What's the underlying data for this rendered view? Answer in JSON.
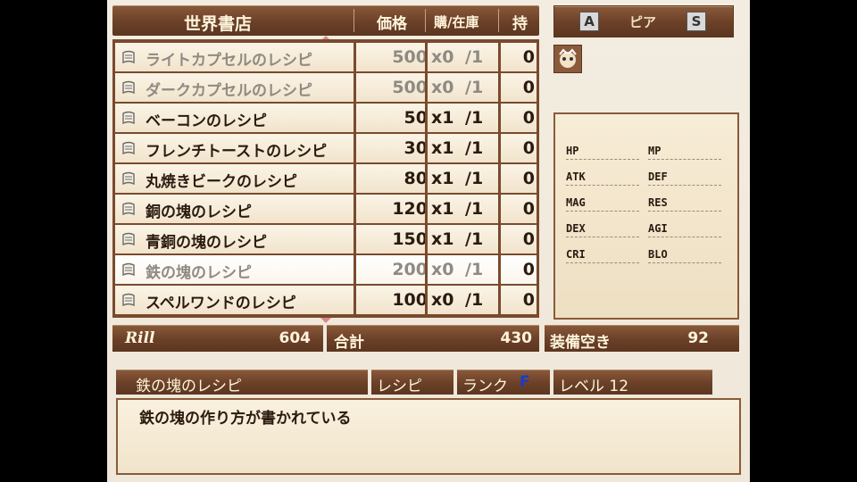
{
  "header": {
    "title": "世界書店",
    "col_price": "価格",
    "col_buy_stock": "購/在庫",
    "col_own": "持"
  },
  "items": [
    {
      "name": "ライトカプセルのレシピ",
      "price": "500",
      "buy": "x0",
      "stock": "/1",
      "own": "0",
      "greyed": true
    },
    {
      "name": "ダークカプセルのレシピ",
      "price": "500",
      "buy": "x0",
      "stock": "/1",
      "own": "0",
      "greyed": true
    },
    {
      "name": "ベーコンのレシピ",
      "price": "50",
      "buy": "x1",
      "stock": "/1",
      "own": "0",
      "greyed": false
    },
    {
      "name": "フレンチトーストのレシピ",
      "price": "30",
      "buy": "x1",
      "stock": "/1",
      "own": "0",
      "greyed": false
    },
    {
      "name": "丸焼きビークのレシピ",
      "price": "80",
      "buy": "x1",
      "stock": "/1",
      "own": "0",
      "greyed": false
    },
    {
      "name": "銅の塊のレシピ",
      "price": "120",
      "buy": "x1",
      "stock": "/1",
      "own": "0",
      "greyed": false
    },
    {
      "name": "青銅の塊のレシピ",
      "price": "150",
      "buy": "x1",
      "stock": "/1",
      "own": "0",
      "greyed": false
    },
    {
      "name": "鉄の塊のレシピ",
      "price": "200",
      "buy": "x0",
      "stock": "/1",
      "own": "0",
      "greyed": true,
      "selected": true
    },
    {
      "name": "スペルワンドのレシピ",
      "price": "100",
      "buy": "x0",
      "stock": "/1",
      "own": "0",
      "greyed": false
    }
  ],
  "totals": {
    "rill_label": "Rill",
    "rill_value": "604",
    "sum_label": "合計",
    "sum_value": "430",
    "slot_label": "装備空き",
    "slot_value": "92"
  },
  "character": {
    "key_left": "A",
    "name": "ピア",
    "key_right": "S"
  },
  "stats": [
    "HP",
    "MP",
    "ATK",
    "DEF",
    "MAG",
    "RES",
    "DEX",
    "AGI",
    "CRI",
    "BLO"
  ],
  "info": {
    "item_name": "鉄の塊のレシピ",
    "category": "レシピ",
    "rank_label": "ランク",
    "rank_value": "F",
    "level": "レベル 12"
  },
  "description": "鉄の塊の作り方が書かれている",
  "colors": {
    "panel_brown": "#6b4028",
    "text_cream": "#fff4dc",
    "rank_blue": "#1a3cc8"
  }
}
